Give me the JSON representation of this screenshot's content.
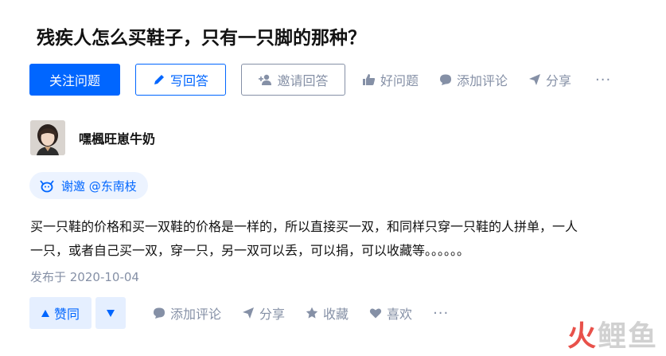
{
  "question": {
    "title": "残疾人怎么买鞋子，只有一只脚的那种？"
  },
  "question_actions": {
    "follow_label": "关注问题",
    "write_label": "写回答",
    "invite_label": "邀请回答",
    "good_question_label": "好问题",
    "add_comment_label": "添加评论",
    "share_label": "分享",
    "more_label": "···"
  },
  "answer": {
    "author_name": "嘿楓旺崽牛奶",
    "invite_badge": "谢邀 @东南枝",
    "content_line1": "买一只鞋的价格和买一双鞋的价格是一样的，所以直接买一双，和同样只穿一只鞋的人拼单，一人",
    "content_line2": "一只，或者自己买一双，穿一只，另一双可以丢，可以捐，可以收藏等。。。。。。",
    "published": "发布于 2020-10-04"
  },
  "answer_actions": {
    "upvote_label": "赞同",
    "add_comment_label": "添加评论",
    "share_label": "分享",
    "favorite_label": "收藏",
    "like_label": "喜欢",
    "more_label": "···"
  },
  "watermark": {
    "part1": "火",
    "part2": "鲤鱼"
  },
  "colors": {
    "accent": "#0066ff",
    "muted": "#8590a6",
    "text": "#121212",
    "badge_bg": "#ecf3ff",
    "vote_bg": "#e5efff"
  }
}
